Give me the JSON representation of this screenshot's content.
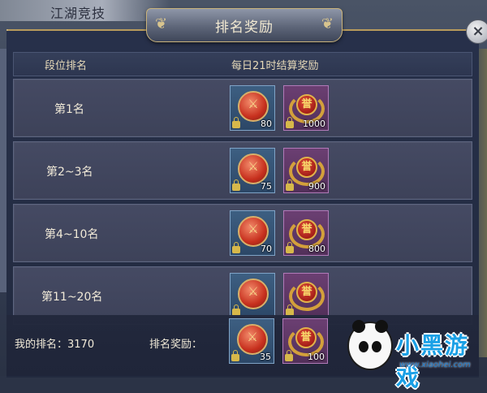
{
  "background": {
    "tab_title": "江湖竞技"
  },
  "window": {
    "title": "排名奖励",
    "close_label": "×"
  },
  "table": {
    "header": {
      "rank_col": "段位排名",
      "reward_col": "每日21时结算奖励"
    },
    "rows": [
      {
        "rank": "第1名",
        "rewards": [
          {
            "icon": "crossed-swords-medal-icon",
            "qty": "80",
            "locked": true
          },
          {
            "icon": "honor-laurel-icon",
            "glyph": "誉",
            "qty": "1000",
            "locked": true
          }
        ]
      },
      {
        "rank": "第2~3名",
        "rewards": [
          {
            "icon": "crossed-swords-medal-icon",
            "qty": "75",
            "locked": true
          },
          {
            "icon": "honor-laurel-icon",
            "glyph": "誉",
            "qty": "900",
            "locked": true
          }
        ]
      },
      {
        "rank": "第4~10名",
        "rewards": [
          {
            "icon": "crossed-swords-medal-icon",
            "qty": "70",
            "locked": true
          },
          {
            "icon": "honor-laurel-icon",
            "glyph": "誉",
            "qty": "800",
            "locked": true
          }
        ]
      },
      {
        "rank": "第11~20名",
        "rewards": [
          {
            "icon": "crossed-swords-medal-icon",
            "qty": "",
            "locked": true
          },
          {
            "icon": "honor-laurel-icon",
            "glyph": "誉",
            "qty": "",
            "locked": true
          }
        ]
      }
    ]
  },
  "footer": {
    "my_rank_label": "我的排名：3170",
    "my_reward_label": "排名奖励：",
    "my_rewards": [
      {
        "icon": "crossed-swords-medal-icon",
        "qty": "35",
        "locked": true
      },
      {
        "icon": "honor-laurel-icon",
        "glyph": "誉",
        "qty": "100",
        "locked": true
      }
    ]
  },
  "watermark": {
    "text": "小黑游戏",
    "url": "www.xiaohei.com"
  },
  "colors": {
    "frame_gold": "#c9b27a",
    "blue_slot": "#3d5f82",
    "purple_slot": "#6b3f72",
    "watermark_blue": "#1aa0e6"
  }
}
